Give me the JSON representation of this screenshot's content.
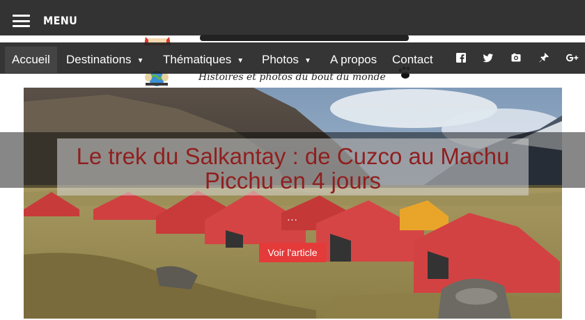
{
  "header": {
    "menu_label": "MENU"
  },
  "logo": {
    "tagline": "Histoires et photos du bout du monde"
  },
  "nav": {
    "items": [
      {
        "label": "Accueil",
        "active": true,
        "dropdown": false
      },
      {
        "label": "Destinations",
        "active": false,
        "dropdown": true
      },
      {
        "label": "Thématiques",
        "active": false,
        "dropdown": true
      },
      {
        "label": "Photos",
        "active": false,
        "dropdown": true
      },
      {
        "label": "A propos",
        "active": false,
        "dropdown": false
      },
      {
        "label": "Contact",
        "active": false,
        "dropdown": false
      }
    ],
    "caret": "▼",
    "social": [
      "facebook-icon",
      "twitter-icon",
      "instagram-icon",
      "pinterest-icon",
      "google-plus-icon"
    ]
  },
  "hero": {
    "title": "Le trek du Salkantay : de Cuzco au Machu Picchu en 4 jours",
    "excerpt": "...",
    "button_label": "Voir l'article"
  },
  "colors": {
    "menubar": "#333333",
    "navbar": "#262626",
    "title": "#8f1f1f",
    "button": "#e43a3a"
  }
}
